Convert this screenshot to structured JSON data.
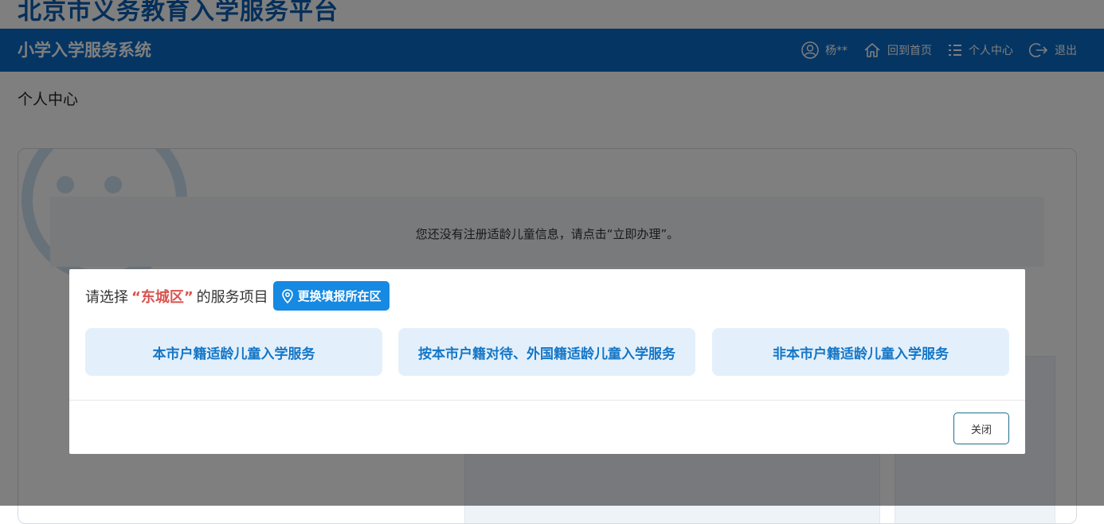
{
  "site": {
    "title": "北京市义务教育入学服务平台"
  },
  "header": {
    "system_name": "小学入学服务系统",
    "nav": {
      "user": "杨**",
      "home": "回到首页",
      "profile": "个人中心",
      "logout": "退出"
    }
  },
  "main": {
    "heading": "个人中心",
    "notice": "您还没有注册适龄儿童信息，请点击“立即办理”。"
  },
  "modal": {
    "prompt_prefix": "请选择",
    "district": "“东城区”",
    "prompt_suffix": "的服务项目",
    "change_district": "更换填报所在区",
    "services": [
      "本市户籍适龄儿童入学服务",
      "按本市户籍对待、外国籍适龄儿童入学服务",
      "非本市户籍适龄儿童入学服务"
    ],
    "close": "关闭"
  },
  "colors": {
    "brand_blue": "#0a6ac7",
    "accent_blue": "#1689e2",
    "district_red": "#d9534f",
    "service_bg": "#e3f0fc",
    "service_text": "#1576c6"
  }
}
